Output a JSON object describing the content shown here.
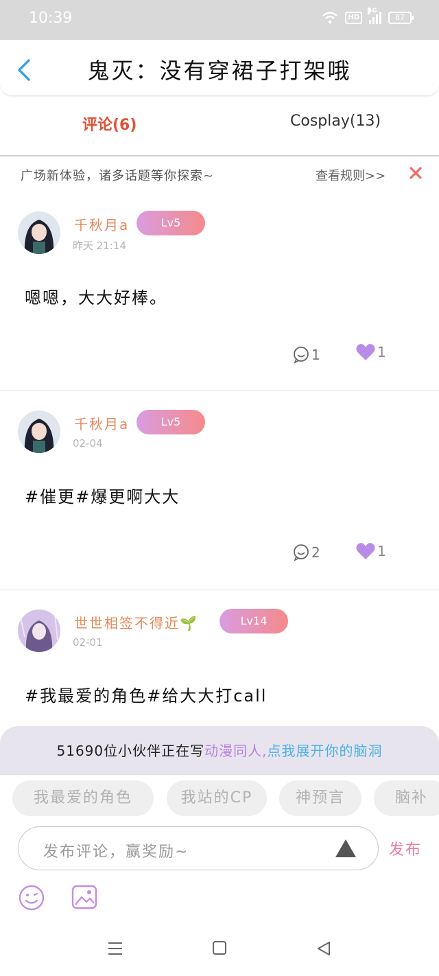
{
  "status_bar": {
    "time": "10:39",
    "hd_label": "HD",
    "network_label": "4G",
    "battery_level": "87"
  },
  "header": {
    "title": "鬼灭：没有穿裙子打架哦"
  },
  "tabs": [
    {
      "label": "评论(6)",
      "active": true
    },
    {
      "label": "Cosplay(13)",
      "active": false
    }
  ],
  "notice": {
    "text": "广场新体验，诸多话题等你探索~",
    "rules_label": "查看规则>>"
  },
  "comments": [
    {
      "name": "千秋月a",
      "level": "Lv5",
      "time": "昨天 21:14",
      "text": "嗯嗯，大大好棒。",
      "replies": "1",
      "likes": "1"
    },
    {
      "name": "千秋月a",
      "level": "Lv5",
      "time": "02-04",
      "text": "#催更#爆更啊大大",
      "replies": "2",
      "likes": "1"
    },
    {
      "name": "世世相签不得近🌱",
      "level": "Lv14",
      "time": "02-01",
      "text": "#我最爱的角色#给大大打call"
    }
  ],
  "promo": {
    "prefix": "51690位小伙伴正在写",
    "highlight1": "动漫同人,",
    "highlight2": "点我展开你的脑洞"
  },
  "topics": [
    "我最爱的角色",
    "我站的CP",
    "神预言",
    "脑补"
  ],
  "input": {
    "placeholder": "发布评论，赢奖励~",
    "publish_label": "发布"
  },
  "colors": {
    "accent_orange": "#e0533a",
    "name_orange": "#e8875a",
    "level_start": "#d99ce0",
    "level_end": "#f58a8a",
    "like_purple": "#b98ce8",
    "publish_pink": "#f07aa0"
  }
}
